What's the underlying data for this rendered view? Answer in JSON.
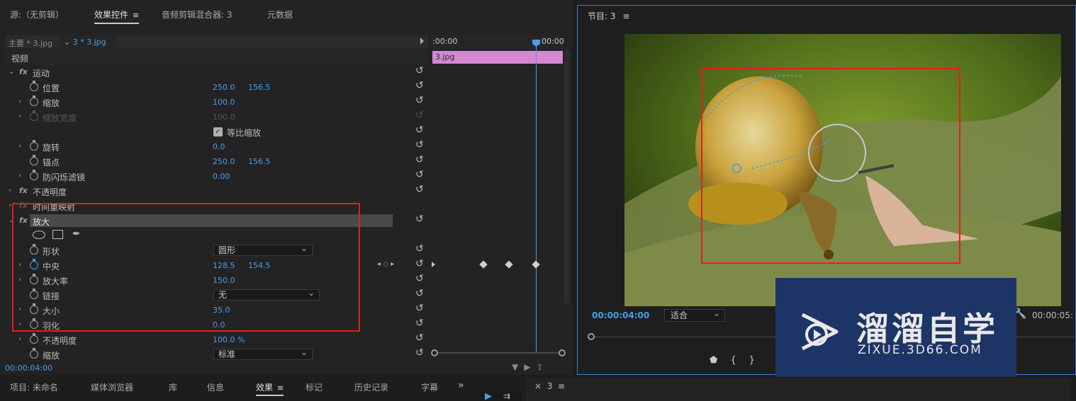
{
  "left_tabs": {
    "source": "源:（无剪辑）",
    "effect_controls": "效果控件",
    "audio_mixer": "音频剪辑混合器: 3",
    "metadata": "元数据"
  },
  "sequence_bar": {
    "main": "主要 * 3.jpg",
    "clip": "3 * 3.jpg"
  },
  "timeline": {
    "start_tc": ":00:00",
    "end_tc": "00:00",
    "clip_name": "3.jpg"
  },
  "properties": {
    "video_header": "视频",
    "motion": "运动",
    "position": {
      "label": "位置",
      "x": "250.0",
      "y": "156.5"
    },
    "scale": {
      "label": "缩放",
      "value": "100.0"
    },
    "scale_width": {
      "label": "缩放宽度",
      "value": "100.0"
    },
    "uniform_scale": "等比缩放",
    "rotation": {
      "label": "旋转",
      "value": "0.0"
    },
    "anchor": {
      "label": "锚点",
      "x": "250.0",
      "y": "156.5"
    },
    "antiflicker": {
      "label": "防闪烁滤镜",
      "value": "0.00"
    },
    "opacity_section": "不透明度",
    "time_remap": "时间重映射",
    "magnify": "放大",
    "shape": {
      "label": "形状",
      "value": "圆形"
    },
    "center": {
      "label": "中央",
      "x": "128.5",
      "y": "154.5"
    },
    "magnification": {
      "label": "放大率",
      "value": "150.0"
    },
    "link": {
      "label": "链接",
      "value": "无"
    },
    "size": {
      "label": "大小",
      "value": "35.0"
    },
    "feather": {
      "label": "羽化",
      "value": "0.0"
    },
    "opacity": {
      "label": "不透明度",
      "value": "100.0 %"
    },
    "blend": {
      "label": "缩放",
      "value": "标准"
    }
  },
  "left_timecode": "00:00:04:00",
  "program": {
    "title": "节目: 3",
    "timecode": "00:00:04:00",
    "fit": "适合",
    "duration": "00:00:05:"
  },
  "watermark": {
    "brand": "溜溜自学",
    "url": "ZIXUE.3D66.COM"
  },
  "bottom_tabs": {
    "project": "项目: 未命名",
    "media_browser": "媒体浏览器",
    "library": "库",
    "info": "信息",
    "effects": "效果",
    "markers": "标记",
    "history": "历史记录",
    "captions": "字幕",
    "sequence": "3"
  },
  "colors": {
    "accent_blue": "#4a9ce8",
    "clip_pink": "#d786d2",
    "highlight_red": "#e02020",
    "watermark_bg": "#1d3566"
  }
}
